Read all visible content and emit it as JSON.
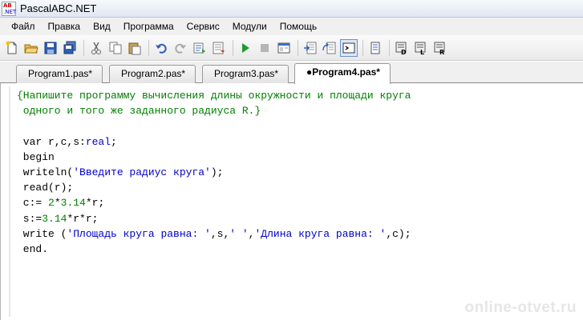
{
  "window": {
    "title": "PascalABC.NET",
    "icon_text": "ABC .NET"
  },
  "menu": [
    "Файл",
    "Правка",
    "Вид",
    "Программа",
    "Сервис",
    "Модули",
    "Помощь"
  ],
  "toolbar": {
    "buttons": [
      "new-file",
      "open-folder",
      "save",
      "save-all",
      "cut",
      "copy",
      "paste",
      "undo",
      "redo",
      "compile",
      "run",
      "stop",
      "debug",
      "step-into",
      "step-over",
      "output-window",
      "form",
      "code-d",
      "code-l",
      "code-r"
    ]
  },
  "tabs": [
    {
      "label": "Program1.pas*",
      "active": false
    },
    {
      "label": "Program2.pas*",
      "active": false
    },
    {
      "label": "Program3.pas*",
      "active": false
    },
    {
      "label": "●Program4.pas*",
      "active": true
    }
  ],
  "editor": {
    "lines": [
      [
        {
          "t": "{Напишите программу вычисления длины окружности и площади круга",
          "c": "cmt"
        }
      ],
      [
        {
          "t": " одного и того же заданного радиуса R.}",
          "c": "cmt"
        }
      ],
      [
        {
          "t": "",
          "c": "kw"
        }
      ],
      [
        {
          "t": " var r,c,s:",
          "c": "kw"
        },
        {
          "t": "real",
          "c": "type"
        },
        {
          "t": ";",
          "c": "kw"
        }
      ],
      [
        {
          "t": " begin",
          "c": "kw"
        }
      ],
      [
        {
          "t": " writeln(",
          "c": "kw"
        },
        {
          "t": "'Введите радиус круга'",
          "c": "str"
        },
        {
          "t": ");",
          "c": "kw"
        }
      ],
      [
        {
          "t": " read(r);",
          "c": "kw"
        }
      ],
      [
        {
          "t": " c:= ",
          "c": "kw"
        },
        {
          "t": "2",
          "c": "num"
        },
        {
          "t": "*",
          "c": "kw"
        },
        {
          "t": "3.14",
          "c": "num"
        },
        {
          "t": "*r;",
          "c": "kw"
        }
      ],
      [
        {
          "t": " s:=",
          "c": "kw"
        },
        {
          "t": "3.14",
          "c": "num"
        },
        {
          "t": "*r*r;",
          "c": "kw"
        }
      ],
      [
        {
          "t": " write (",
          "c": "kw"
        },
        {
          "t": "'Площадь круга равна: '",
          "c": "str"
        },
        {
          "t": ",s,",
          "c": "kw"
        },
        {
          "t": "' '",
          "c": "str"
        },
        {
          "t": ",",
          "c": "kw"
        },
        {
          "t": "'Длина круга равна: '",
          "c": "str"
        },
        {
          "t": ",c);",
          "c": "kw"
        }
      ],
      [
        {
          "t": " end.",
          "c": "kw"
        }
      ]
    ]
  },
  "watermark": "online-otvet.ru",
  "colors": {
    "comment": "#008000",
    "string": "#0000c8",
    "number": "#008000",
    "type": "#0000c8"
  }
}
